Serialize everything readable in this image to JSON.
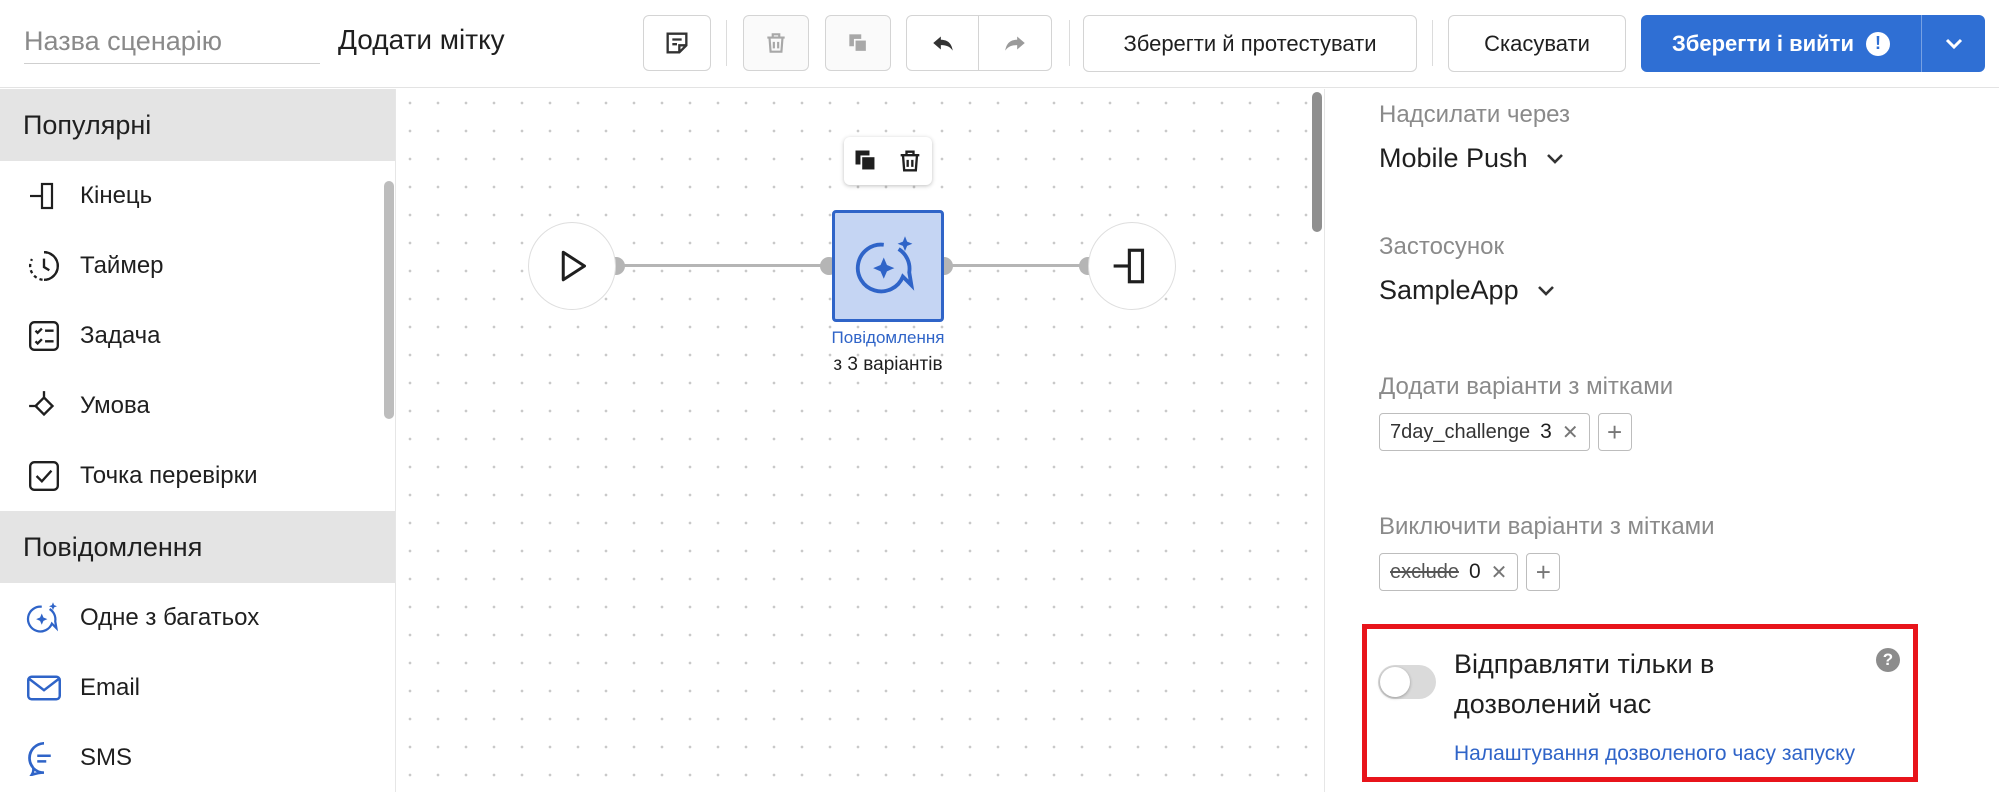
{
  "header": {
    "scenario_placeholder": "Назва сценарію",
    "title": "Додати мітку",
    "save_test_label": "Зберегти й протестувати",
    "cancel_label": "Скасувати",
    "save_exit_label": "Зберегти і вийти",
    "alert_glyph": "!"
  },
  "sidebar": {
    "sections": [
      {
        "title": "Популярні",
        "items": [
          {
            "label": "Кінець",
            "icon": "end-icon"
          },
          {
            "label": "Таймер",
            "icon": "timer-icon"
          },
          {
            "label": "Задача",
            "icon": "task-icon"
          },
          {
            "label": "Умова",
            "icon": "condition-icon"
          },
          {
            "label": "Точка перевірки",
            "icon": "checkpoint-icon"
          }
        ]
      },
      {
        "title": "Повідомлення",
        "items": [
          {
            "label": "Одне з багатьох",
            "icon": "sparkle-chat-icon"
          },
          {
            "label": "Email",
            "icon": "email-icon"
          },
          {
            "label": "SMS",
            "icon": "sms-icon"
          }
        ]
      }
    ]
  },
  "canvas": {
    "message_node": {
      "label": "Повідомлення",
      "sub": "з 3 варіантів"
    }
  },
  "panel": {
    "send_via": {
      "label": "Надсилати через",
      "value": "Mobile Push"
    },
    "app": {
      "label": "Застосунок",
      "value": "SampleApp"
    },
    "include": {
      "label": "Додати варіанти з мітками",
      "chips": [
        {
          "tag": "7day_challenge",
          "count": "3"
        }
      ]
    },
    "exclude": {
      "label": "Виключити варіанти з мітками",
      "chips": [
        {
          "tag": "exclude",
          "count": "0"
        }
      ]
    },
    "allowed_time": {
      "toggle_on": false,
      "text": "Відправляти тільки в дозволений час",
      "help_glyph": "?",
      "link": "Налаштування дозволеного часу запуску"
    }
  },
  "colors": {
    "primary": "#2f6fd4",
    "node_fill": "#c5d5f3",
    "link": "#2f64c8",
    "highlight": "#e8141b"
  }
}
